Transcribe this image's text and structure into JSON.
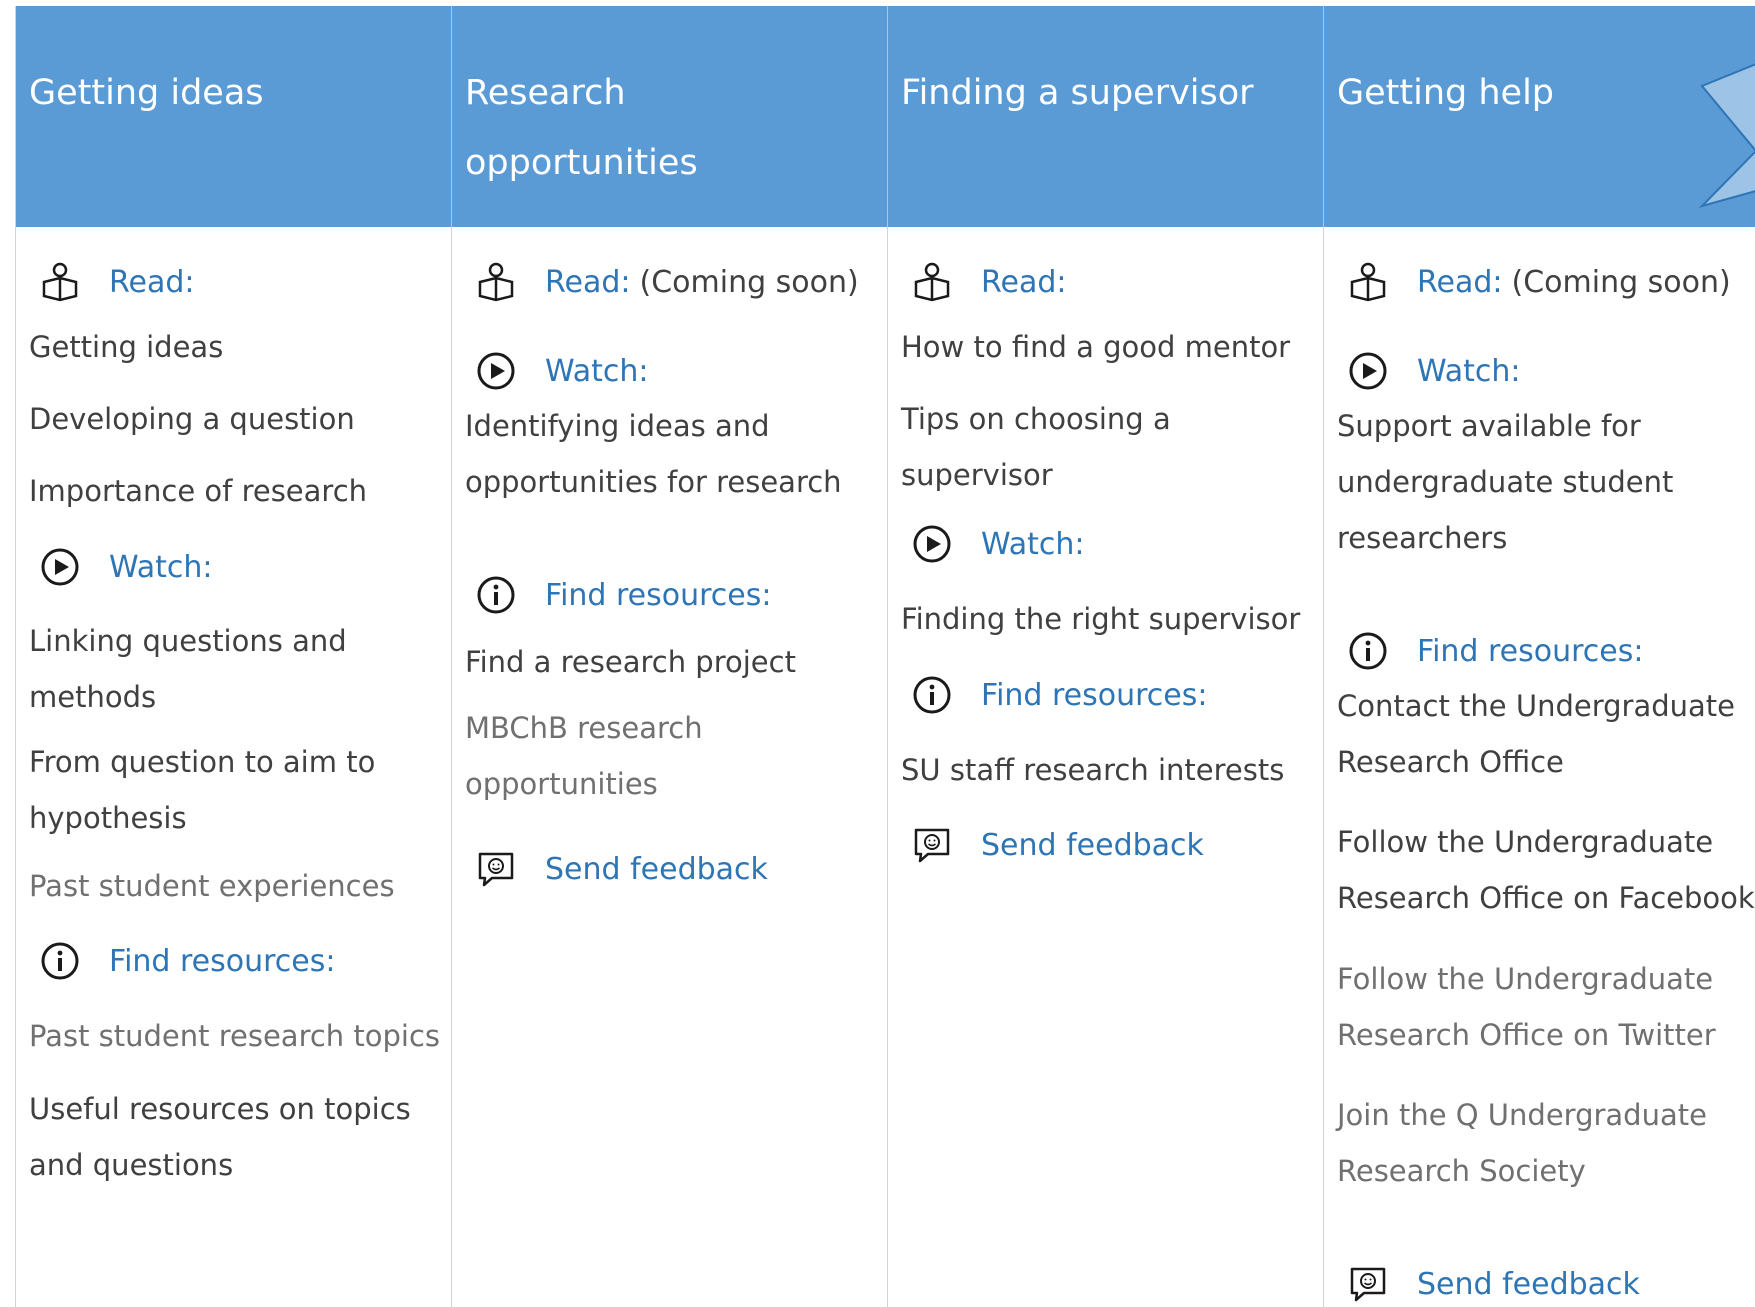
{
  "columns": [
    {
      "header": [
        "Getting ideas"
      ],
      "blocks": [
        {
          "type": "label",
          "icon": "book-reader-icon",
          "label": "Read:",
          "note": ""
        },
        {
          "type": "item",
          "text": [
            "Getting ideas"
          ]
        },
        {
          "type": "item",
          "text": [
            "Developing a question"
          ]
        },
        {
          "type": "item",
          "text": [
            "Importance of research"
          ]
        },
        {
          "type": "label",
          "icon": "play-circle-icon",
          "label": "Watch:",
          "note": ""
        },
        {
          "type": "item",
          "text": [
            "Linking questions and",
            "methods"
          ]
        },
        {
          "type": "item",
          "text": [
            "From question to aim to",
            "hypothesis"
          ]
        },
        {
          "type": "item",
          "text": [
            "Past student experiences"
          ],
          "muted": true
        },
        {
          "type": "label",
          "icon": "info-circle-icon",
          "label": "Find resources:",
          "note": ""
        },
        {
          "type": "item",
          "text": [
            "Past student research topics"
          ],
          "muted": true
        },
        {
          "type": "item",
          "text": [
            "Useful resources on topics",
            "and questions"
          ]
        }
      ]
    },
    {
      "header": [
        "Research",
        "opportunities"
      ],
      "blocks": [
        {
          "type": "label",
          "icon": "book-reader-icon",
          "label": "Read:",
          "note": "(Coming soon)"
        },
        {
          "type": "label",
          "icon": "play-circle-icon",
          "label": "Watch:",
          "note": ""
        },
        {
          "type": "item",
          "text": [
            "Identifying ideas and",
            "opportunities for research"
          ]
        },
        {
          "type": "label",
          "icon": "info-circle-icon",
          "label": "Find resources:",
          "note": ""
        },
        {
          "type": "item",
          "text": [
            "Find a research project"
          ]
        },
        {
          "type": "item",
          "text": [
            "MBChB research",
            "opportunities"
          ],
          "muted": true
        },
        {
          "type": "label",
          "icon": "feedback-icon",
          "label": "Send feedback",
          "note": ""
        }
      ]
    },
    {
      "header": [
        "Finding a supervisor"
      ],
      "blocks": [
        {
          "type": "label",
          "icon": "book-reader-icon",
          "label": "Read:",
          "note": ""
        },
        {
          "type": "item",
          "text": [
            "How to find a good mentor"
          ]
        },
        {
          "type": "item",
          "text": [
            "Tips on choosing a",
            "supervisor"
          ]
        },
        {
          "type": "label",
          "icon": "play-circle-icon",
          "label": "Watch:",
          "note": ""
        },
        {
          "type": "item",
          "text": [
            "Finding the right supervisor"
          ]
        },
        {
          "type": "label",
          "icon": "info-circle-icon",
          "label": "Find resources:",
          "note": ""
        },
        {
          "type": "item",
          "text": [
            "SU staff research interests"
          ]
        },
        {
          "type": "label",
          "icon": "feedback-icon",
          "label": "Send feedback",
          "note": ""
        }
      ]
    },
    {
      "header": [
        "Getting help"
      ],
      "blocks": [
        {
          "type": "label",
          "icon": "book-reader-icon",
          "label": "Read:",
          "note": "(Coming soon)"
        },
        {
          "type": "label",
          "icon": "play-circle-icon",
          "label": "Watch:",
          "note": ""
        },
        {
          "type": "item",
          "text": [
            "Support available for",
            "undergraduate student",
            "researchers"
          ]
        },
        {
          "type": "label",
          "icon": "info-circle-icon",
          "label": "Find resources:",
          "note": ""
        },
        {
          "type": "item",
          "text": [
            "Contact the Undergraduate",
            "Research Office"
          ]
        },
        {
          "type": "item",
          "text": [
            "Follow the Undergraduate",
            "Research Office on Facebook"
          ]
        },
        {
          "type": "item",
          "text": [
            "Follow the Undergraduate",
            "Research Office on Twitter"
          ],
          "muted": true
        },
        {
          "type": "item",
          "text": [
            "Join the Q Undergraduate",
            "Research Society"
          ],
          "muted": true
        },
        {
          "type": "label",
          "icon": "feedback-icon",
          "label": "Send feedback",
          "note": ""
        }
      ]
    }
  ],
  "colors": {
    "header_bg": "#5b9bd5",
    "link": "#2e75b6",
    "text": "#404040",
    "muted_text": "#707070"
  }
}
